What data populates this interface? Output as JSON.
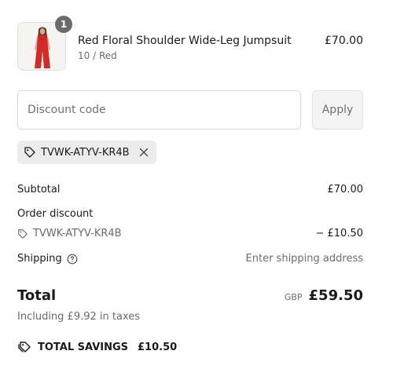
{
  "product": {
    "quantity": "1",
    "title": "Red Floral Shoulder Wide-Leg Jumpsuit",
    "variant": "10 / Red",
    "price": "£70.00"
  },
  "discount": {
    "placeholder": "Discount code",
    "apply_label": "Apply",
    "applied_code": "TVWK-ATYV-KR4B"
  },
  "summary": {
    "subtotal_label": "Subtotal",
    "subtotal_value": "£70.00",
    "order_discount_label": "Order discount",
    "order_discount_code": "TVWK-ATYV-KR4B",
    "order_discount_value": "− £10.50",
    "shipping_label": "Shipping",
    "shipping_value": "Enter shipping address"
  },
  "total": {
    "label": "Total",
    "currency": "GBP",
    "amount": "£59.50",
    "taxes": "Including £9.92 in taxes"
  },
  "savings": {
    "label": "TOTAL SAVINGS",
    "amount": "£10.50"
  },
  "colors": {
    "text": "#1a1a1a",
    "muted": "#6b6b6b",
    "chip_bg": "#ececec",
    "badge_bg": "#6b6b6b",
    "product_red": "#d32a2a"
  },
  "icons": {
    "tag": "tag-icon",
    "close": "close-icon",
    "info": "info-icon",
    "savings": "savings-tag-icon"
  }
}
